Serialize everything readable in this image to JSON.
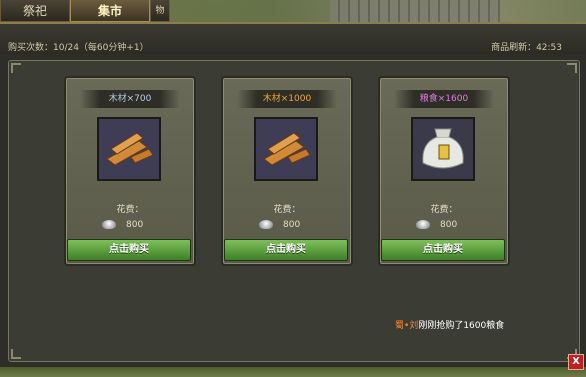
{
  "tabs": [
    {
      "label": "祭祀"
    },
    {
      "label": "集市"
    },
    {
      "label": "物"
    }
  ],
  "header": {
    "buy_count": "购买次数：10/24（每60分钟+1）",
    "refresh": "商品刷新：42:53"
  },
  "cards": [
    {
      "title": "木材×700",
      "title_color": "#b8c9e6",
      "item": "wood-planks-icon",
      "cost_label": "花费：",
      "cost": "800",
      "button": "点击购买"
    },
    {
      "title": "木材×1000",
      "title_color": "#f0a431",
      "item": "wood-planks-icon",
      "cost_label": "花费：",
      "cost": "800",
      "button": "点击购买"
    },
    {
      "title": "粮食×1600",
      "title_color": "#e07ae0",
      "item": "grain-sack-icon",
      "cost_label": "花费：",
      "cost": "800",
      "button": "点击购买"
    }
  ],
  "notice": {
    "player": "蜀•刘",
    "message": "刚刚抢购了1600粮食"
  },
  "close_label": "X",
  "colors": {
    "button_green": "#5ea33d",
    "accent_gold": "#a58c52"
  }
}
